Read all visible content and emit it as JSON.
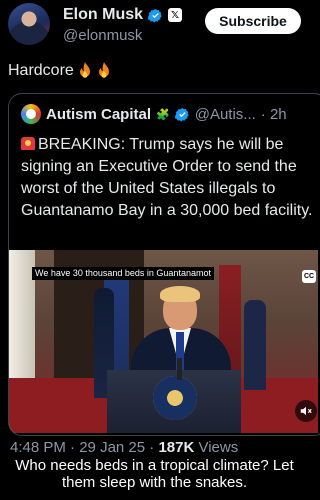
{
  "post": {
    "author_name": "Elon Musk",
    "author_handle": "@elonmusk",
    "subscribe_label": "Subscribe",
    "text": "Hardcore",
    "badge_x": "𝕏"
  },
  "quote": {
    "author_name": "Autism Capital",
    "emoji": "🧩",
    "handle": "@Autis...",
    "time": "· 2h",
    "body": "BREAKING: Trump says he will be signing an Executive Order to send the worst of the United States illegals to Guantanamo Bay in a 30,000 bed facility.",
    "video": {
      "caption": "We have 30 thousand beds in Guantanamot",
      "cc_label": "CC"
    }
  },
  "meta": {
    "time": "4:48 PM",
    "date": "29 Jan 25",
    "views_count": "187K",
    "views_label": "Views",
    "sep": "·"
  },
  "overlay_caption": "Who needs beds in a tropical climate? Let them sleep with the snakes.",
  "colors": {
    "background": "#000000",
    "text": "#e7e9ea",
    "muted": "#8b98a5",
    "verified": "#1d9bf0",
    "fire": "#f5821f"
  },
  "icons": [
    "verified-icon",
    "x-logo-icon",
    "fire-icon",
    "puzzle-icon",
    "siren-icon",
    "cc-icon",
    "mute-icon"
  ]
}
